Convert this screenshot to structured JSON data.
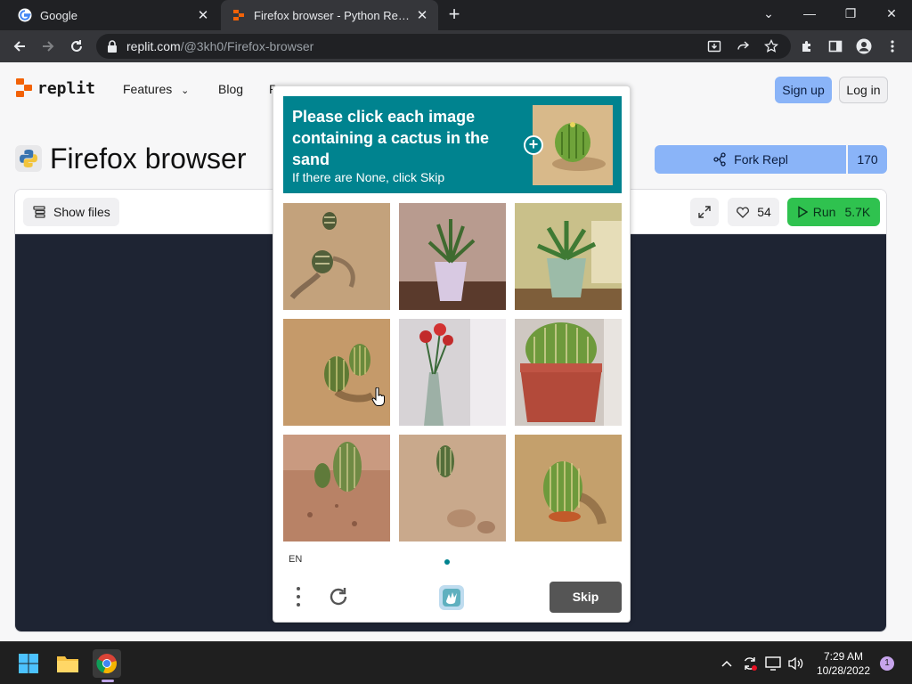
{
  "browser": {
    "tabs": [
      {
        "title": "Google",
        "active": false
      },
      {
        "title": "Firefox browser - Python Repl - Replit",
        "active": true
      }
    ],
    "url_host": "replit.com",
    "url_path": "/@3kh0/Firefox-browser"
  },
  "replit": {
    "logo_text": "replit",
    "nav": {
      "features": "Features",
      "blog": "Blog",
      "pricing_partial": "P"
    },
    "sign_up": "Sign up",
    "log_in": "Log in",
    "repl_title": "Firefox browser",
    "fork_label": "Fork Repl",
    "fork_count": "170",
    "show_files": "Show files",
    "likes": "54",
    "run_label": "Run",
    "run_count": "5.7K"
  },
  "captcha": {
    "prompt_main": "Please click each image containing a cactus in the sand",
    "prompt_sub": "If there are None, click Skip",
    "tiles": [
      {
        "name": "tile-cacti-shadows-sand"
      },
      {
        "name": "tile-potted-plant-pink"
      },
      {
        "name": "tile-potted-plant-green"
      },
      {
        "name": "tile-cacti-on-sand"
      },
      {
        "name": "tile-red-flowers-vase"
      },
      {
        "name": "tile-cactus-red-pot"
      },
      {
        "name": "tile-cactus-reddish-sand"
      },
      {
        "name": "tile-small-cactus-sand"
      },
      {
        "name": "tile-cactus-desert-sand"
      }
    ],
    "language": "EN",
    "skip_label": "Skip",
    "accent": "#00838f"
  },
  "taskbar": {
    "time": "7:29 AM",
    "date": "10/28/2022",
    "notifications": "1"
  }
}
